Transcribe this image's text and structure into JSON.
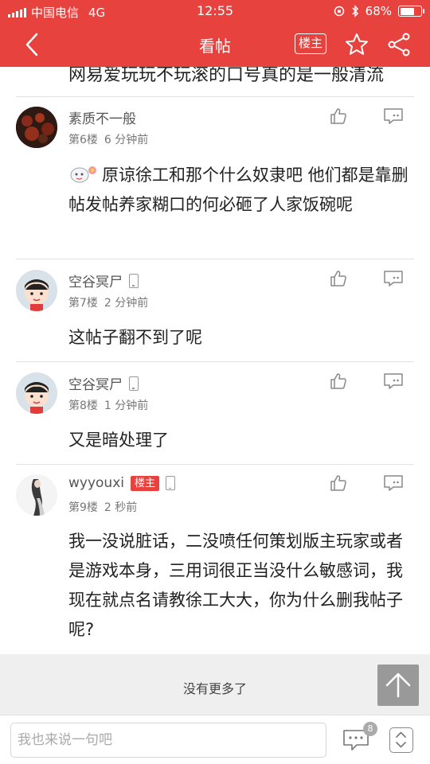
{
  "status_bar": {
    "carrier": "中国电信",
    "network": "4G",
    "time": "12:55",
    "battery": "68%",
    "battery_level": 0.68
  },
  "nav": {
    "title": "看帖",
    "owner_label": "楼主"
  },
  "prev_text": "网易爱玩玩不玩滚的口号真的是一般清流",
  "posts": [
    {
      "username": "素质不一般",
      "floor": "第6楼",
      "time": "6 分钟前",
      "body": "原谅徐工和那个什么奴隶吧 他们都是靠删帖发帖养家糊口的何必砸了人家饭碗呢"
    },
    {
      "username": "空谷冥尸",
      "floor": "第7楼",
      "time": "2 分钟前",
      "body": "这帖子翻不到了呢"
    },
    {
      "username": "空谷冥尸",
      "floor": "第8楼",
      "time": "1 分钟前",
      "body": "又是暗处理了"
    },
    {
      "username": "wyyouxi",
      "owner_tag": "楼主",
      "floor": "第9楼",
      "time": "2 秒前",
      "body": "我一没说脏话，二没喷任何策划版主玩家或者是游戏本身，三用词很正当没什么敏感词，我现在就点名请教徐工大大，你为什么删我帖子呢?"
    }
  ],
  "no_more": "没有更多了",
  "bottom": {
    "placeholder": "我也来说一句吧",
    "comment_count": "8"
  },
  "colors": {
    "brand": "#e8423f"
  }
}
